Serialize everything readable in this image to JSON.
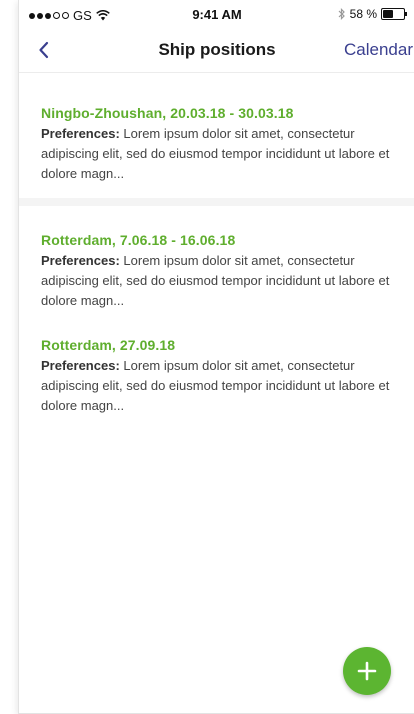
{
  "status_bar": {
    "carrier": "GS",
    "time": "9:41 AM",
    "battery_percent": "58 %",
    "battery_level": 0.58
  },
  "nav": {
    "back_icon": "chevron-left-icon",
    "title": "Ship positions",
    "action_label": "Calendar"
  },
  "colors": {
    "accent_green": "#5fae2e",
    "nav_link": "#3a3f8f",
    "fab": "#5cb531"
  },
  "positions": [
    {
      "title": "Ningbo-Zhoushan, 20.03.18 - 30.03.18",
      "preferences_label": "Preferences:",
      "preferences_text": "Lorem ipsum dolor sit amet, consectetur adipiscing elit, sed do eiusmod tempor incididunt ut labore et dolore magn..."
    },
    {
      "title": "Rotterdam, 7.06.18 - 16.06.18",
      "preferences_label": "Preferences:",
      "preferences_text": "Lorem ipsum dolor sit amet, consectetur adipiscing elit, sed do eiusmod tempor incididunt ut labore et dolore magn..."
    },
    {
      "title": "Rotterdam, 27.09.18",
      "preferences_label": "Preferences:",
      "preferences_text": "Lorem ipsum dolor sit amet, consectetur adipiscing elit, sed do eiusmod tempor incididunt ut labore et dolore magn..."
    }
  ],
  "fab": {
    "icon": "plus-icon"
  }
}
